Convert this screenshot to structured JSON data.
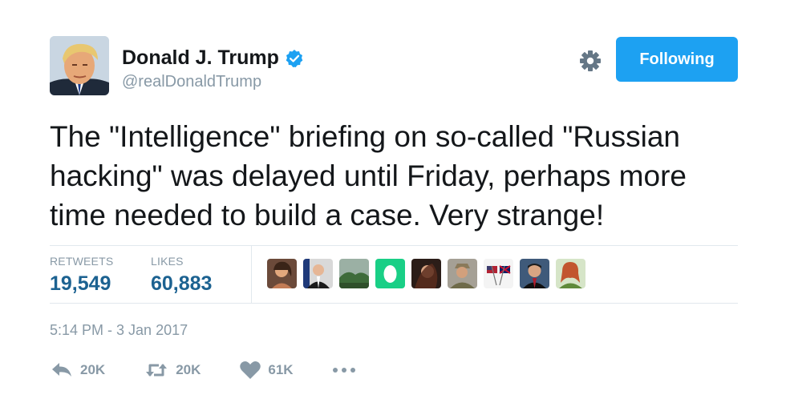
{
  "author": {
    "name": "Donald J. Trump",
    "handle": "@realDonaldTrump",
    "verified": true
  },
  "follow_button": {
    "label": "Following",
    "color": "#1da1f2"
  },
  "tweet": {
    "text": "The \"Intelligence\" briefing on so-called \"Russian hacking\" was delayed until Friday, perhaps more time needed to build a case. Very strange!"
  },
  "stats": {
    "retweets_label": "RETWEETS",
    "retweets_value": "19,549",
    "likes_label": "LIKES",
    "likes_value": "60,883"
  },
  "likers": [
    {
      "icon": "user-avatar"
    },
    {
      "icon": "user-avatar"
    },
    {
      "icon": "landscape-avatar"
    },
    {
      "icon": "egg-avatar"
    },
    {
      "icon": "user-avatar"
    },
    {
      "icon": "user-avatar"
    },
    {
      "icon": "flags-avatar"
    },
    {
      "icon": "user-avatar"
    },
    {
      "icon": "user-avatar"
    }
  ],
  "timestamp": "5:14 PM - 3 Jan 2017",
  "actions": {
    "reply_count": "20K",
    "retweet_count": "20K",
    "like_count": "61K"
  },
  "colors": {
    "stat_value": "#1c6291",
    "muted": "#8899a6",
    "divider": "#e1e8ed"
  }
}
